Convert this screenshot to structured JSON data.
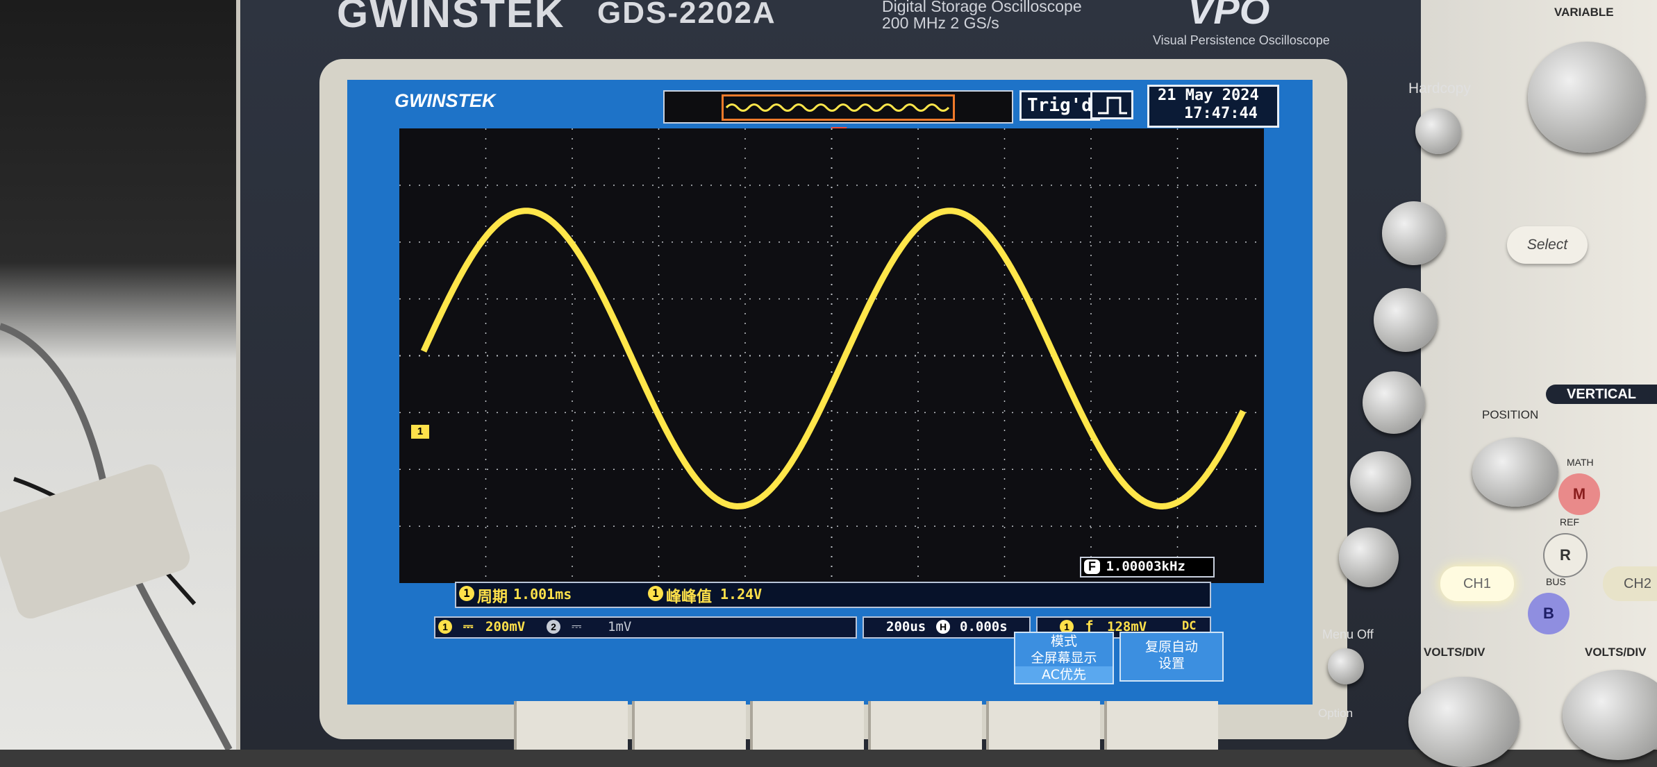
{
  "device": {
    "brand": "GWINSTEK",
    "model": "GDS-2202A",
    "subtitle_line1": "Digital Storage Oscilloscope",
    "subtitle_line2": "200 MHz  2 GS/s",
    "vpo_logo": "VPO",
    "vpo_caption": "Visual Persistence Oscilloscope"
  },
  "screen": {
    "logo": "GWINSTEK",
    "trigger_status": "Trig'd",
    "date": "21 May 2024",
    "time": "17:47:44",
    "frequency_label": "F",
    "frequency": "1.00003kHz",
    "measurement1_label": "周期",
    "measurement1_value": "1.001ms",
    "measurement2_label": "峰峰值",
    "measurement2_value": "1.24V",
    "ch1_marker": "1",
    "ch1_scale": "200mV",
    "ch2_scale": "1mV",
    "timebase": "200us",
    "h_position": "0.000s",
    "trigger_source": "1",
    "trigger_level": "128mV",
    "trigger_coupling": "DC",
    "menu_mode_lines": [
      "模式",
      "全屏幕显示",
      "AC优先"
    ],
    "menu_autoset_lines": [
      "复原自动",
      "设置"
    ]
  },
  "panel": {
    "variable": "VARIABLE",
    "hardcopy": "Hardcopy",
    "select": "Select",
    "vertical": "VERTICAL",
    "position": "POSITION",
    "math": "MATH",
    "math_btn": "M",
    "ref": "REF",
    "ref_btn": "R",
    "bus": "BUS",
    "bus_btn": "B",
    "ch1": "CH1",
    "ch2": "CH2",
    "volts_div_1": "VOLTS/DIV",
    "volts_div_2": "VOLTS/DIV",
    "menu_off": "Menu Off",
    "option": "Option"
  },
  "waveform": {
    "type": "sine",
    "color": "#ffe64a",
    "period_ms": 1.001,
    "peak_to_peak_v": 1.24
  }
}
